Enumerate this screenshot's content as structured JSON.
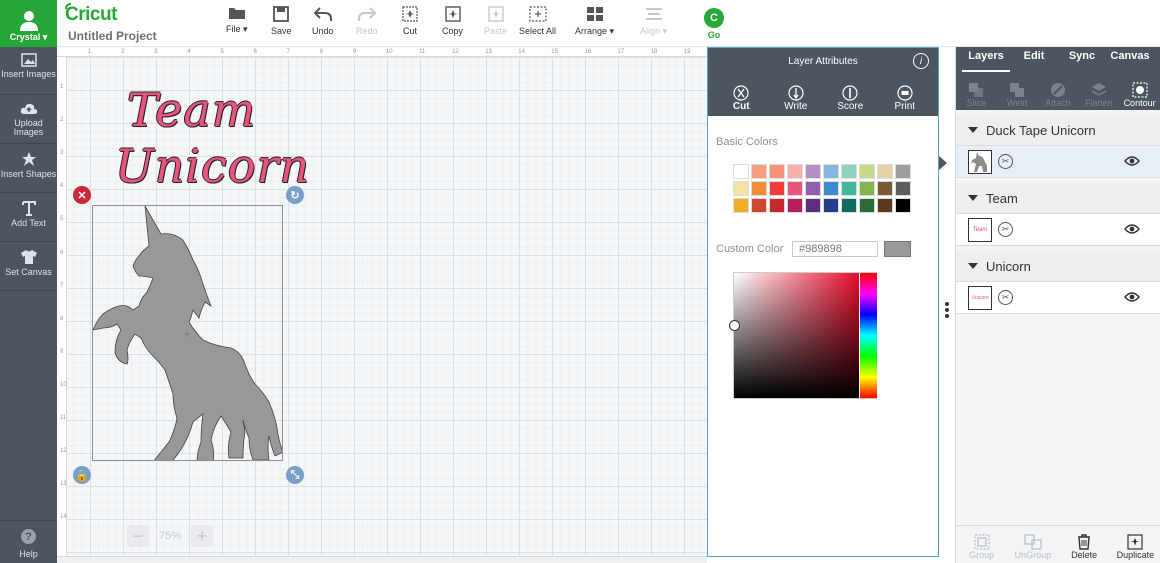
{
  "sidebar": {
    "user_name": "Crystal",
    "items": [
      {
        "label": "Insert Images"
      },
      {
        "label": "Upload Images"
      },
      {
        "label": "Insert Shapes"
      },
      {
        "label": "Add Text"
      },
      {
        "label": "Set Canvas"
      }
    ],
    "help_label": "Help"
  },
  "header": {
    "logo": "Cricut",
    "project_title": "Untitled Project",
    "toolbar": {
      "file": "File",
      "save": "Save",
      "undo": "Undo",
      "redo": "Redo",
      "cut": "Cut",
      "copy": "Copy",
      "paste": "Paste",
      "select_all": "Select All",
      "arrange": "Arrange",
      "align": "Align",
      "go": "Go"
    }
  },
  "canvas": {
    "ruler_top": [
      "1",
      "2",
      "3",
      "4",
      "5",
      "6",
      "7",
      "8",
      "9",
      "10",
      "11",
      "12",
      "13",
      "14",
      "15",
      "16",
      "17",
      "18",
      "19"
    ],
    "ruler_left": [
      "1",
      "2",
      "3",
      "4",
      "5",
      "6",
      "7",
      "8",
      "9",
      "10",
      "11",
      "12",
      "13",
      "14"
    ],
    "text_line1": "Team",
    "text_line2": "Unicorn",
    "zoom_level": "75%"
  },
  "layer_attributes": {
    "title": "Layer Attributes",
    "tabs": [
      {
        "label": "Cut",
        "active": true
      },
      {
        "label": "Write",
        "active": false
      },
      {
        "label": "Score",
        "active": false
      },
      {
        "label": "Print",
        "active": false
      }
    ],
    "basic_colors_label": "Basic Colors",
    "basic_colors": [
      "#ffffff",
      "#f6a07f",
      "#f4937a",
      "#f5b0a9",
      "#b28fc6",
      "#86b6de",
      "#8fd1b8",
      "#c8d98c",
      "#e3d2a6",
      "#9e9e9e",
      "#f1e3a2",
      "#f08d36",
      "#ef3d3d",
      "#e8547e",
      "#8e5fb0",
      "#3d8bd1",
      "#3fb89a",
      "#82b54d",
      "#7a5a34",
      "#5d5d5d",
      "#efad25",
      "#d4472f",
      "#c7282d",
      "#b81d5d",
      "#5b2d83",
      "#263f8c",
      "#0f6b5f",
      "#2a6b37",
      "#5c3b1c",
      "#000000"
    ],
    "custom_color_label": "Custom Color",
    "custom_color_value": "#989898",
    "custom_color_current": "#989898"
  },
  "right_panel": {
    "tabs": [
      "Layers",
      "Edit",
      "Sync",
      "Canvas"
    ],
    "tools": [
      "Slice",
      "Weld",
      "Attach",
      "Flatten",
      "Contour"
    ],
    "groups": [
      {
        "name": "Duck Tape Unicorn"
      },
      {
        "name": "Team"
      },
      {
        "name": "Unicorn"
      }
    ],
    "bottom_actions": [
      "Group",
      "UnGroup",
      "Delete",
      "Duplicate"
    ]
  },
  "colors": {
    "accent_green": "#27a736",
    "sidebar_dark": "#4d5560",
    "text_pink": "#e8547e"
  }
}
